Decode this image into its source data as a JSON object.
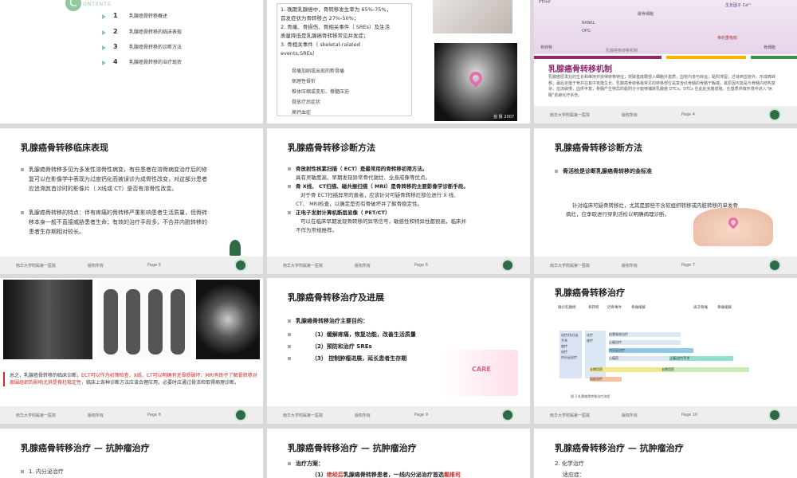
{
  "s1": {
    "logo_letter": "C",
    "contents_label": "ONTENTS",
    "items": [
      {
        "num": "1",
        "label": "乳腺癌骨转移概述"
      },
      {
        "num": "2",
        "label": "乳腺癌骨转移的临床表现"
      },
      {
        "num": "3",
        "label": "乳腺癌骨转移的诊断方法"
      },
      {
        "num": "4",
        "label": "乳腺癌骨转移的治疗现状"
      }
    ]
  },
  "s2": {
    "lines": [
      "1. 晚期乳腺癌中，骨转移发生率为 65%-75%，",
      "首发症状为骨转移占 27%-50%；",
      "2. 骨痛、骨损伤、骨相关事件（ SREs）及生活",
      "质量降低是乳腺癌骨转移常见并发症；",
      "3. 骨相关事件（ skeletal-ralated",
      "events,SREs）"
    ],
    "sub_items": [
      "骨痛加剧或出现的新骨痛",
      "病理性骨折",
      "椎体压缩或变形、脊髓压迫",
      "骨放疗后症状",
      "高钙血症"
    ],
    "xray_caption": "拍 摄 2007"
  },
  "s3": {
    "title": "乳腺癌骨转移机制",
    "diagram_labels": [
      "PTHrP",
      "生长因子 Ca²⁺",
      "破骨细胞",
      "RANKL",
      "OPG",
      "骨的重吸收",
      "骨转移",
      "骨细胞"
    ],
    "bottom_caption": "乳腺癌骨转移机制",
    "body": "乳腺癌原发灶的生长和维持并获得转移特征；突破基底膜侵入细胞外基质，血管内渗与转运；黏附滞留；迁徙到血管外，形成微转移；最后定植于骨并在其中克隆生长。乳腺癌骨转移最常见的转移部位是富含红骨髓的骨骼干骺端，其原因可能是与骨髓内结构复杂，血流缓慢，血供丰富，骨髓产生特异的黏附分子能够捕获乳腺癌 DTCs，DTCs 在此处克隆增殖，在基质供微环境中进入\"休眠\"逃避化疗杀伤。",
    "footer_org": "南华大学附属第一医院",
    "footer_rights": "版权所有",
    "footer_page": "Page  4"
  },
  "s5": {
    "title": "乳腺癌骨转移临床表现",
    "p1": [
      "乳腺癌骨转移多见为多发性溶骨性病变，有些患者在溶骨病变治疗后的修",
      "复可以在影像学中表现为过度钙化而被误诊为成骨性改变，对这部分患者",
      "应追溯其首诊时的影像片（ X线或 CT）是否有溶骨性改变。"
    ],
    "p2": [
      "乳腺癌骨转移的特点：伴有疼痛的骨转移严重影响患者生活质量，但骨转",
      "移本身一般不直接威胁患者生命；有效的治疗手段多，不合并内脏转移的",
      "患者生存期相对较长。"
    ],
    "footer_org": "南华大学附属第一医院",
    "footer_rights": "版权所有",
    "footer_page": "Page  5"
  },
  "s6": {
    "title": "乳腺癌骨转移诊断方法",
    "b1": "骨放射性核素扫描（ ECT）是最常用的骨转移初筛方法。",
    "b1_sub": "具有灵敏度高、早期发现异常骨代谢灶、全身成像等优点。",
    "b2": "骨 X线、 CT扫描、磁共振扫描（ MRI）是骨转移的主要影像学诊断手段。",
    "b2_sub": [
      "对于骨 ECT扫描异常的患者，应该针对可疑骨转移灶部位进行 X 线、",
      "CT、 MRI检查，以确定是否有骨破坏并了解骨稳定性。"
    ],
    "b3": "正电子发射计算机断层显像（ PET/CT）",
    "b3_sub": [
      "可以在临床早期发现骨转移的异常信号，敏感性和特异性都很高，临床并",
      "不作为常规推荐。"
    ],
    "footer_org": "南华大学附属第一医院",
    "footer_rights": "版权所有",
    "footer_page": "Page  6"
  },
  "s7": {
    "title": "乳腺癌骨转移诊断方法",
    "b1": "骨活检是诊断乳腺癌骨转移的金标准",
    "body": [
      "针对临床可疑骨转移灶，尤其是那些不含软组织转移或内脏转移的单发骨",
      "病灶，应争取进行穿刺活检以明确病理诊断。"
    ],
    "footer_org": "南华大学附属第一医院",
    "footer_rights": "版权所有",
    "footer_page": "Page  7"
  },
  "s8": {
    "summary_prefix": "总之，乳腺癌骨转移的临床诊断，",
    "summary_red": "ECT可以作为初筛检查，X线、CT可以明确有无骨质破坏、MRI有助于了解骨转移对周围组织的影响尤其是脊柱稳定性，",
    "summary_suffix": "临床上各种诊断方法应该合理应用，必要时应通过骨活检取得病理诊断。",
    "footer_org": "南华大学附属第一医院",
    "footer_rights": "版权所有",
    "footer_page": "Page  8"
  },
  "s9": {
    "title": "乳腺癌骨转移治疗及进展",
    "b1": "乳腺癌骨转移治疗主要目的：",
    "goals": [
      "（1）缓解疼痛，恢复功能，改善生活质量",
      "（2）预防和治疗 SREs",
      "（3）  控制肿瘤进展，延长患者生存期"
    ],
    "image_text": "CARE",
    "footer_org": "南华大学附属第一医院",
    "footer_rights": "版权所有",
    "footer_page": "Page  9"
  },
  "s10": {
    "title": "乳腺癌骨转移治疗",
    "headers": [
      "确诊乳腺癌",
      "骨转移",
      "近骨事件",
      "骨痛缓解",
      "再次骨痛",
      "骨痛缓解"
    ],
    "left_list": [
      "化疗/内分泌",
      "手术",
      "放疗",
      "化疗",
      "内分泌治疗"
    ],
    "bars": [
      "抗骨吸收治疗",
      "止痛治疗",
      "内分泌治疗",
      "止痛药",
      "止痛治疗/手术",
      "长期用药",
      "长期用药",
      "局部治疗"
    ],
    "caption": "图 3  乳腺癌骨转移治疗流程",
    "footer_org": "南华大学附属第一医院",
    "footer_rights": "版权所有",
    "footer_page": "Page  10"
  },
  "s11": {
    "title": "乳腺癌骨转移治疗 — 抗肿瘤治疗",
    "item": "1. 内分泌治疗"
  },
  "s12": {
    "title": "乳腺癌骨转移治疗 — 抗肿瘤治疗",
    "b1": "治疗方案：",
    "line": "（1）",
    "red": "绝经后",
    "rest": "乳腺癌骨转移患者，一线内分泌治疗首选",
    "red2": "氟维司"
  },
  "s13": {
    "title": "乳腺癌骨转移治疗 — 抗肿瘤治疗",
    "item": "2. 化学治疗",
    "sub": "适应症："
  }
}
